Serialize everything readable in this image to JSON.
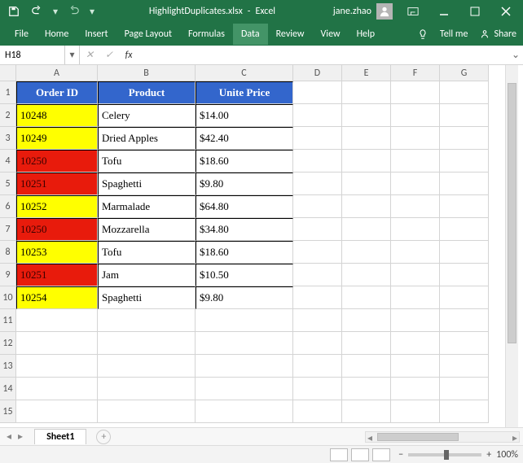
{
  "title": {
    "filename": "HighlightDuplicates.xlsx",
    "app": "Excel"
  },
  "user": {
    "name": "jane.zhao"
  },
  "ribbon": {
    "tabs": [
      "File",
      "Home",
      "Insert",
      "Page Layout",
      "Formulas",
      "Data",
      "Review",
      "View",
      "Help"
    ],
    "active": "Data",
    "tellme": "Tell me",
    "share": "Share"
  },
  "namebox": "H18",
  "formula": "",
  "columns": [
    "A",
    "B",
    "C",
    "D",
    "E",
    "F",
    "G"
  ],
  "rowcount": 15,
  "headers": [
    "Order ID",
    "Product",
    "Unite Price"
  ],
  "table": {
    "rows": [
      {
        "id": "10248",
        "product": "Celery",
        "price": "$14.00",
        "color": "yellow"
      },
      {
        "id": "10249",
        "product": "Dried Apples",
        "price": "$42.40",
        "color": "yellow"
      },
      {
        "id": "10250",
        "product": "Tofu",
        "price": "$18.60",
        "color": "red"
      },
      {
        "id": "10251",
        "product": "Spaghetti",
        "price": "$9.80",
        "color": "red"
      },
      {
        "id": "10252",
        "product": "Marmalade",
        "price": "$64.80",
        "color": "yellow"
      },
      {
        "id": "10250",
        "product": "Mozzarella",
        "price": "$34.80",
        "color": "red"
      },
      {
        "id": "10253",
        "product": "Tofu",
        "price": "$18.60",
        "color": "yellow"
      },
      {
        "id": "10251",
        "product": "Jam",
        "price": "$10.50",
        "color": "red"
      },
      {
        "id": "10254",
        "product": "Spaghetti",
        "price": "$9.80",
        "color": "yellow"
      }
    ],
    "palette": {
      "yellow": "#ffff00",
      "red": "#e81b0c"
    }
  },
  "sheet": {
    "active": "Sheet1"
  },
  "zoom": "100%",
  "chart_data": {
    "type": "table",
    "columns": [
      "Order ID",
      "Product",
      "Unite Price"
    ],
    "rows": [
      [
        "10248",
        "Celery",
        "$14.00"
      ],
      [
        "10249",
        "Dried Apples",
        "$42.40"
      ],
      [
        "10250",
        "Tofu",
        "$18.60"
      ],
      [
        "10251",
        "Spaghetti",
        "$9.80"
      ],
      [
        "10252",
        "Marmalade",
        "$64.80"
      ],
      [
        "10250",
        "Mozzarella",
        "$34.80"
      ],
      [
        "10253",
        "Tofu",
        "$18.60"
      ],
      [
        "10251",
        "Jam",
        "$10.50"
      ],
      [
        "10254",
        "Spaghetti",
        "$9.80"
      ]
    ]
  }
}
